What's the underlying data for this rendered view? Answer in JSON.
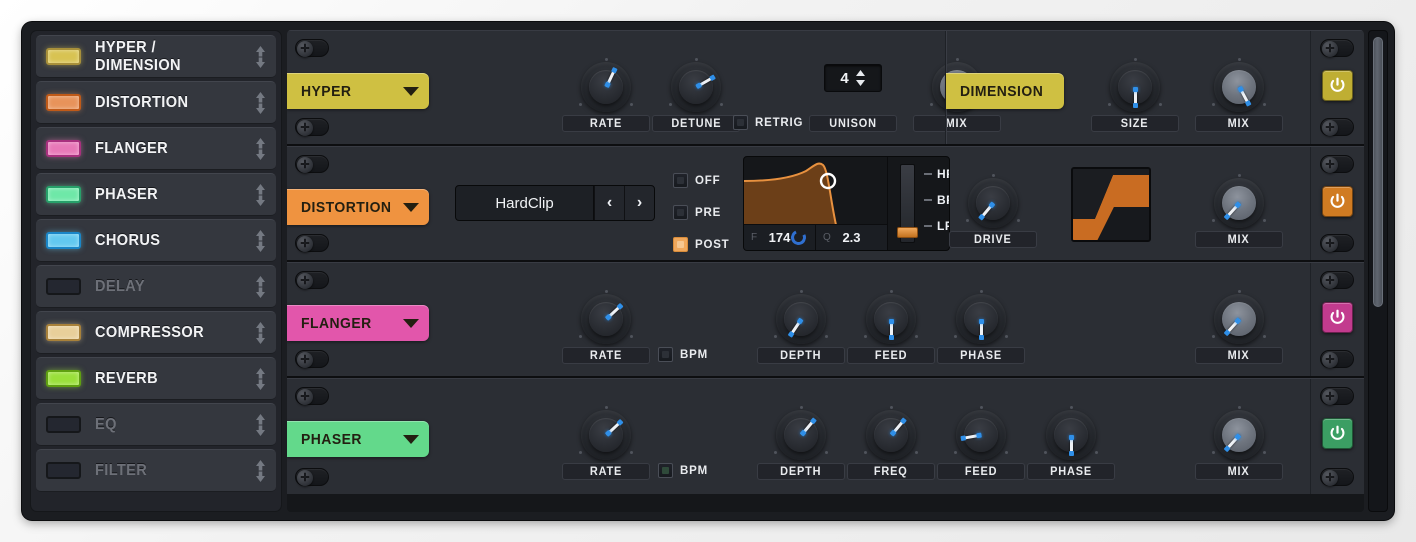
{
  "sidebar": {
    "items": [
      {
        "label": "HYPER / DIMENSION",
        "enabled": true,
        "led": "#d8c352",
        "led_edge": "#a8903a",
        "icon": "led-indicator"
      },
      {
        "label": "DISTORTION",
        "enabled": true,
        "led": "#e8935a",
        "led_edge": "#c05a18",
        "icon": "led-indicator"
      },
      {
        "label": "FLANGER",
        "enabled": true,
        "led": "#e878b8",
        "led_edge": "#a8307e",
        "icon": "led-indicator"
      },
      {
        "label": "PHASER",
        "enabled": true,
        "led": "#6ee8a8",
        "led_edge": "#27a06a",
        "icon": "led-indicator"
      },
      {
        "label": "CHORUS",
        "enabled": true,
        "led": "#62c8f0",
        "led_edge": "#1a86c8",
        "icon": "led-indicator"
      },
      {
        "label": "DELAY",
        "enabled": false,
        "led": "#2a2d33",
        "led_edge": "#15171a",
        "icon": "led-indicator"
      },
      {
        "label": "COMPRESSOR",
        "enabled": true,
        "led": "#e8cf9a",
        "led_edge": "#a8813a",
        "icon": "led-indicator"
      },
      {
        "label": "REVERB",
        "enabled": true,
        "led": "#9ae03a",
        "led_edge": "#5fa010",
        "icon": "led-indicator"
      },
      {
        "label": "EQ",
        "enabled": false,
        "led": "#2a2d33",
        "led_edge": "#15171a",
        "icon": "led-indicator"
      },
      {
        "label": "FILTER",
        "enabled": false,
        "led": "#2a2d33",
        "led_edge": "#15171a",
        "icon": "led-indicator"
      }
    ],
    "reorder_icon": "up-down-arrows-icon"
  },
  "rows": [
    {
      "tab_label": "HYPER",
      "tab_color": "#cfc042",
      "power_color": "#bfae33",
      "power_on": true,
      "knobs": [
        {
          "name": "RATE",
          "angle": -155,
          "style": "dark"
        },
        {
          "name": "DETUNE",
          "angle": -120,
          "style": "dark"
        },
        {
          "name": "MIX",
          "angle": -8,
          "style": "light"
        }
      ],
      "checkbox": {
        "label": "RETRIG",
        "checked": false
      },
      "stepper": {
        "value": "4",
        "label": "UNISON"
      }
    },
    {
      "tab_label": "DISTORTION",
      "tab_color": "#ef9340",
      "power_color": "#d07b22",
      "power_on": true,
      "knobs": [
        {
          "name": "DRIVE",
          "angle": 40,
          "style": "dark"
        },
        {
          "name": "MIX",
          "angle": 42,
          "style": "light"
        }
      ],
      "mode_select": {
        "value": "HardClip",
        "prev": "‹",
        "next": "›"
      },
      "routing": [
        {
          "label": "OFF",
          "checked": false
        },
        {
          "label": "PRE",
          "checked": false
        },
        {
          "label": "POST",
          "checked": true
        }
      ],
      "filter": {
        "freq_tag": "F",
        "freq_value": "174",
        "q_tag": "Q",
        "q_value": "2.3",
        "modes": [
          "HP",
          "BP",
          "LP"
        ],
        "selected_mode": "LP"
      },
      "waveshape": "hardclip-s-curve"
    },
    {
      "tab_label": "FLANGER",
      "tab_color": "#e256ab",
      "power_color": "#c23b8e",
      "power_on": true,
      "knobs": [
        {
          "name": "RATE",
          "angle": -133,
          "style": "dark"
        },
        {
          "name": "DEPTH",
          "angle": 34,
          "style": "dark"
        },
        {
          "name": "FEED",
          "angle": 0,
          "style": "dark"
        },
        {
          "name": "PHASE",
          "angle": 0,
          "style": "dark"
        },
        {
          "name": "MIX",
          "angle": 42,
          "style": "light"
        }
      ],
      "checkbox": {
        "label": "BPM",
        "checked": false
      }
    },
    {
      "tab_label": "PHASER",
      "tab_color": "#63d98b",
      "power_color": "#3b9e63",
      "power_on": true,
      "knobs": [
        {
          "name": "RATE",
          "angle": -133,
          "style": "dark"
        },
        {
          "name": "DEPTH",
          "angle": -140,
          "style": "dark"
        },
        {
          "name": "FREQ",
          "angle": -140,
          "style": "dark"
        },
        {
          "name": "FEED",
          "angle": 80,
          "style": "dark"
        },
        {
          "name": "PHASE",
          "angle": 0,
          "style": "dark"
        },
        {
          "name": "MIX",
          "angle": 42,
          "style": "light"
        }
      ],
      "checkbox": {
        "label": "BPM",
        "checked": false,
        "tint": "green"
      }
    }
  ],
  "dimension": {
    "tab_label": "DIMENSION",
    "tab_color": "#cfc042",
    "knobs": [
      {
        "name": "SIZE",
        "angle": 0,
        "style": "dark"
      },
      {
        "name": "MIX",
        "angle": -28,
        "style": "light"
      }
    ]
  },
  "icons": {
    "power": "power-icon",
    "bypass_pill": "bypass-toggle-icon",
    "caret": "chevron-down-icon",
    "stepper": "stepper-arrows-icon"
  },
  "scrollbar": {
    "name": "vertical-scrollbar"
  }
}
